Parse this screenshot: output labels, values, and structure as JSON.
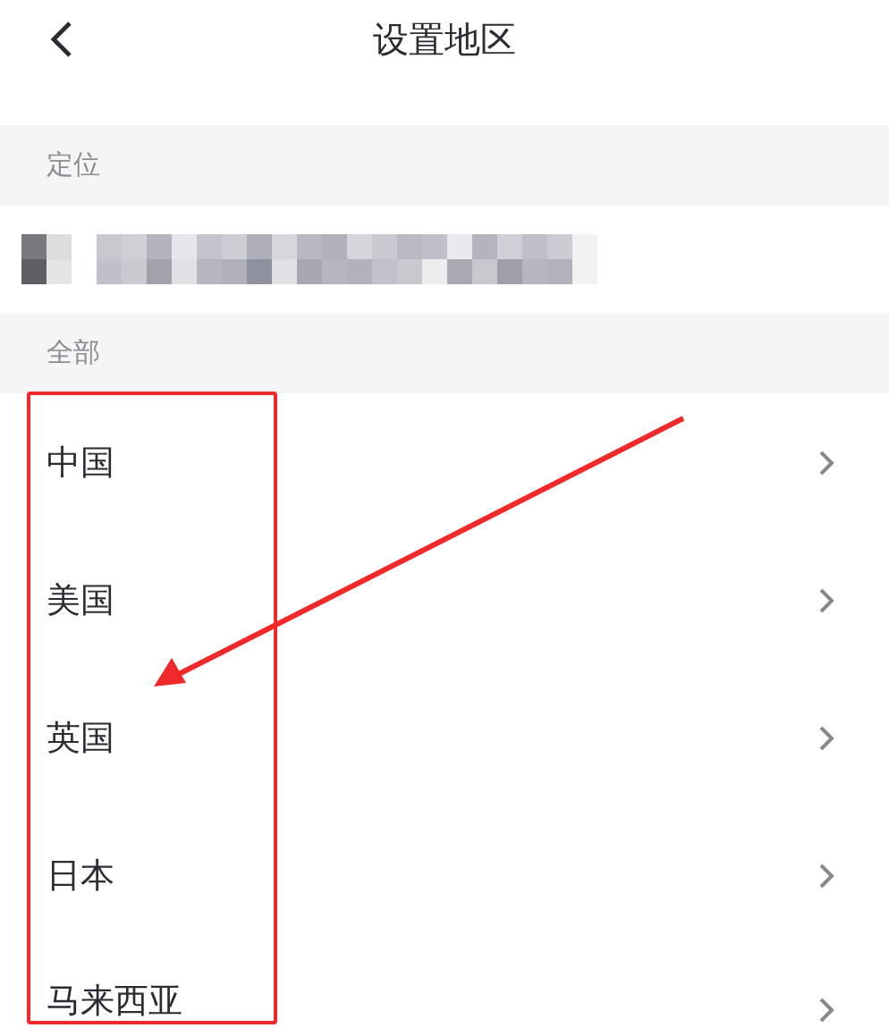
{
  "header": {
    "title": "设置地区"
  },
  "sections": [
    {
      "heading": "定位",
      "kind": "location"
    },
    {
      "heading": "全部",
      "kind": "list",
      "items": [
        {
          "label": "中国"
        },
        {
          "label": "美国"
        },
        {
          "label": "英国"
        },
        {
          "label": "日本"
        },
        {
          "label": "马来西亚"
        }
      ]
    }
  ]
}
